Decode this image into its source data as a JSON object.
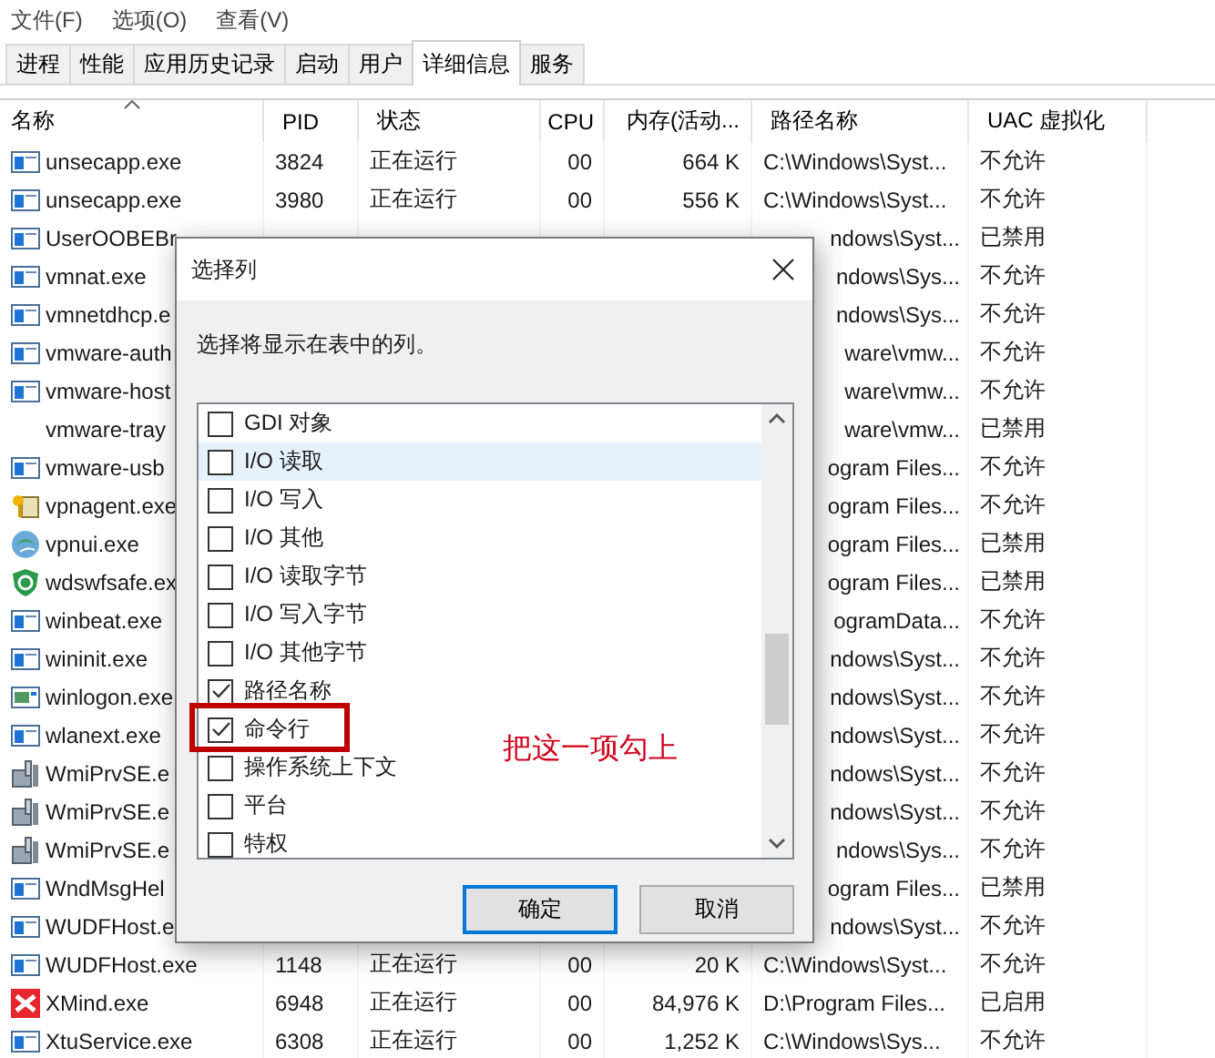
{
  "menu": [
    "文件(F)",
    "选项(O)",
    "查看(V)"
  ],
  "tabs": [
    {
      "label": "进程",
      "selected": false
    },
    {
      "label": "性能",
      "selected": false
    },
    {
      "label": "应用历史记录",
      "selected": false
    },
    {
      "label": "启动",
      "selected": false
    },
    {
      "label": "用户",
      "selected": false
    },
    {
      "label": "详细信息",
      "selected": true
    },
    {
      "label": "服务",
      "selected": false
    }
  ],
  "columns": [
    {
      "label": "名称",
      "sorted": true
    },
    {
      "label": "PID",
      "sorted": false
    },
    {
      "label": "状态",
      "sorted": false
    },
    {
      "label": "CPU",
      "sorted": false
    },
    {
      "label": "内存(活动...",
      "sorted": false
    },
    {
      "label": "路径名称",
      "sorted": false
    },
    {
      "label": "UAC 虚拟化",
      "sorted": false
    }
  ],
  "rows": [
    {
      "kind": "app",
      "name": "unsecapp.exe",
      "pid": "3824",
      "status": "正在运行",
      "cpu": "00",
      "memory": "664 K",
      "path": "C:\\Windows\\Syst...",
      "uac": "不允许"
    },
    {
      "kind": "app",
      "name": "unsecapp.exe",
      "pid": "3980",
      "status": "正在运行",
      "cpu": "00",
      "memory": "556 K",
      "path": "C:\\Windows\\Syst...",
      "uac": "不允许"
    },
    {
      "kind": "app",
      "name": "UserOOBEBr",
      "path": "ndows\\Syst...",
      "uac": "已禁用"
    },
    {
      "kind": "app",
      "name": "vmnat.exe",
      "path": "ndows\\Sys...",
      "uac": "不允许"
    },
    {
      "kind": "app",
      "name": "vmnetdhcp.e",
      "path": "ndows\\Sys...",
      "uac": "不允许"
    },
    {
      "kind": "app",
      "name": "vmware-auth",
      "path": "ware\\vmw...",
      "uac": "不允许"
    },
    {
      "kind": "app",
      "name": "vmware-host",
      "path": "ware\\vmw...",
      "uac": "不允许"
    },
    {
      "kind": "blank",
      "name": "vmware-tray",
      "path": "ware\\vmw...",
      "uac": "已禁用"
    },
    {
      "kind": "app",
      "name": "vmware-usb",
      "path": "ogram Files...",
      "uac": "不允许"
    },
    {
      "kind": "key",
      "name": "vpnagent.exe",
      "path": "ogram Files...",
      "uac": "不允许"
    },
    {
      "kind": "globe",
      "name": "vpnui.exe",
      "path": "ogram Files...",
      "uac": "已禁用"
    },
    {
      "kind": "shield",
      "name": "wdswfsafe.ex",
      "path": "ogram Files...",
      "uac": "已禁用"
    },
    {
      "kind": "app",
      "name": "winbeat.exe",
      "path": "ogramData...",
      "uac": "不允许"
    },
    {
      "kind": "app",
      "name": "wininit.exe",
      "path": "ndows\\Syst...",
      "uac": "不允许"
    },
    {
      "kind": "console",
      "name": "winlogon.exe",
      "path": "ndows\\Syst...",
      "uac": "不允许"
    },
    {
      "kind": "app",
      "name": "wlanext.exe",
      "path": "ndows\\Syst...",
      "uac": "不允许"
    },
    {
      "kind": "service",
      "name": "WmiPrvSE.e",
      "path": "ndows\\Syst...",
      "uac": "不允许"
    },
    {
      "kind": "service",
      "name": "WmiPrvSE.e",
      "path": "ndows\\Syst...",
      "uac": "不允许"
    },
    {
      "kind": "service",
      "name": "WmiPrvSE.e",
      "path": "ndows\\Sys...",
      "uac": "不允许"
    },
    {
      "kind": "app",
      "name": "WndMsgHel",
      "path": "ogram Files...",
      "uac": "已禁用"
    },
    {
      "kind": "app",
      "name": "WUDFHost.e",
      "path": "ndows\\Syst...",
      "uac": "不允许"
    },
    {
      "kind": "app",
      "name": "WUDFHost.exe",
      "pid": "1148",
      "status": "正在运行",
      "cpu": "00",
      "memory": "20 K",
      "path": "C:\\Windows\\Syst...",
      "uac": "不允许"
    },
    {
      "kind": "xmind",
      "name": "XMind.exe",
      "pid": "6948",
      "status": "正在运行",
      "cpu": "00",
      "memory": "84,976 K",
      "path": "D:\\Program Files...",
      "uac": "已启用"
    },
    {
      "kind": "app",
      "name": "XtuService.exe",
      "pid": "6308",
      "status": "正在运行",
      "cpu": "00",
      "memory": "1,252 K",
      "path": "C:\\Windows\\Sys...",
      "uac": "不允许"
    }
  ],
  "dialog": {
    "title": "选择列",
    "description": "选择将显示在表中的列。",
    "items": [
      {
        "label": "GDI 对象",
        "checked": false,
        "hovered": false,
        "annotated": false
      },
      {
        "label": "I/O 读取",
        "checked": false,
        "hovered": true,
        "annotated": false
      },
      {
        "label": "I/O 写入",
        "checked": false,
        "hovered": false,
        "annotated": false
      },
      {
        "label": "I/O 其他",
        "checked": false,
        "hovered": false,
        "annotated": false
      },
      {
        "label": "I/O 读取字节",
        "checked": false,
        "hovered": false,
        "annotated": false
      },
      {
        "label": "I/O 写入字节",
        "checked": false,
        "hovered": false,
        "annotated": false
      },
      {
        "label": "I/O 其他字节",
        "checked": false,
        "hovered": false,
        "annotated": false
      },
      {
        "label": "路径名称",
        "checked": true,
        "hovered": false,
        "annotated": false
      },
      {
        "label": "命令行",
        "checked": true,
        "hovered": false,
        "annotated": true
      },
      {
        "label": "操作系统上下文",
        "checked": false,
        "hovered": false,
        "annotated": false
      },
      {
        "label": "平台",
        "checked": false,
        "hovered": false,
        "annotated": false
      },
      {
        "label": "特权",
        "checked": false,
        "hovered": false,
        "annotated": false
      }
    ],
    "annotation": "把这一项勾上",
    "buttons": [
      {
        "label": "确定",
        "focused": true
      },
      {
        "label": "取消",
        "focused": false
      }
    ]
  }
}
